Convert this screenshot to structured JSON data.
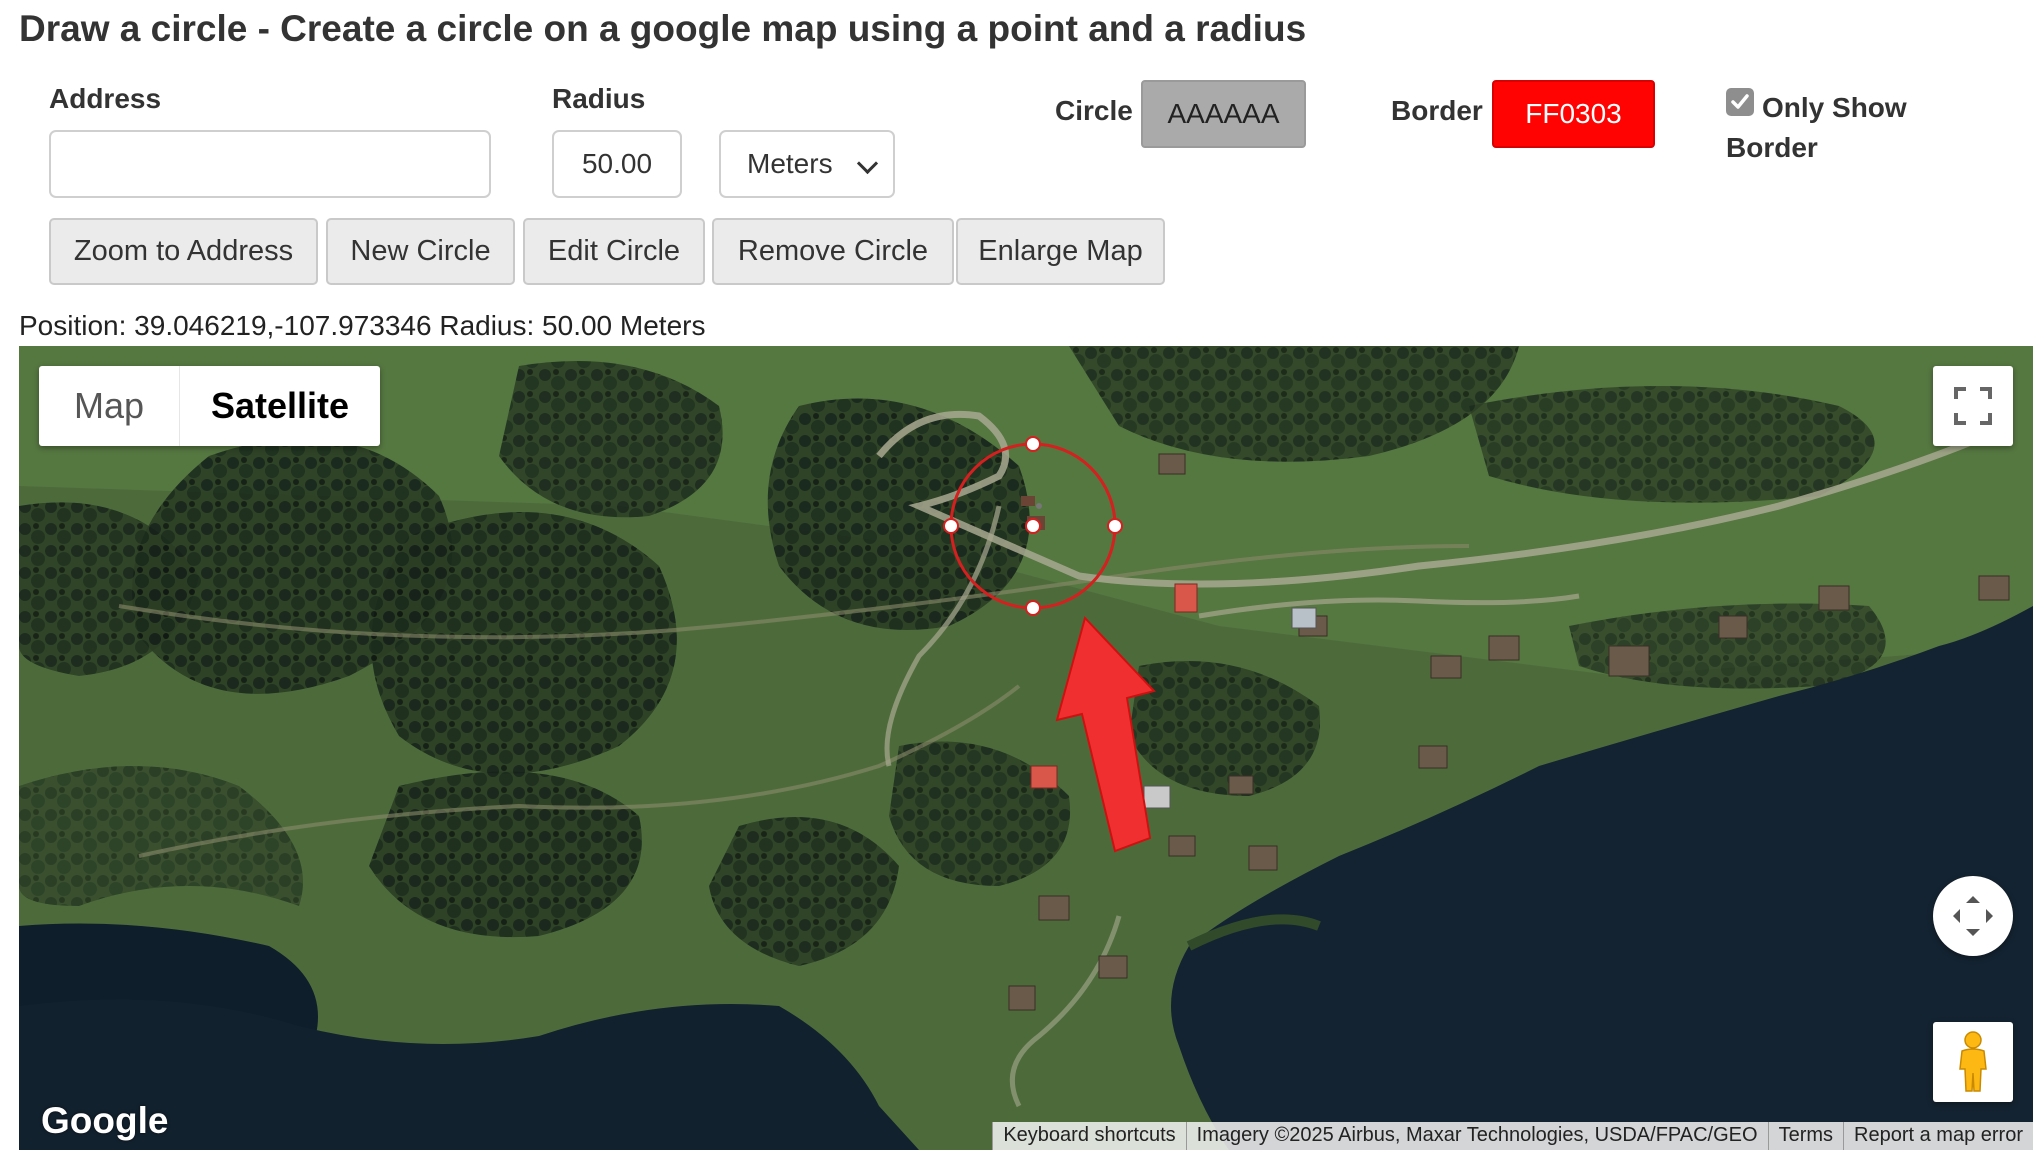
{
  "page": {
    "title": "Draw a circle - Create a circle on a google map using a point and a radius"
  },
  "form": {
    "address_label": "Address",
    "address_value": "",
    "radius_label": "Radius",
    "radius_value": "50.00",
    "unit_selected": "Meters",
    "circle_label": "Circle",
    "circle_color": "AAAAAA",
    "border_label": "Border",
    "border_color": "FF0303",
    "only_show_border_label": "Only Show Border",
    "only_show_border_checked": true
  },
  "buttons": {
    "zoom": "Zoom to Address",
    "new": "New Circle",
    "edit": "Edit Circle",
    "remove": "Remove Circle",
    "enlarge": "Enlarge Map"
  },
  "status": "Position: 39.046219,-107.973346 Radius: 50.00 Meters",
  "map": {
    "type_map": "Map",
    "type_satellite": "Satellite",
    "selected_type": "Satellite",
    "logo": "Google",
    "attribution": {
      "shortcuts": "Keyboard shortcuts",
      "imagery": "Imagery ©2025 Airbus, Maxar Technologies, USDA/FPAC/GEO",
      "terms": "Terms",
      "report": "Report a map error"
    },
    "circle_stroke": "#d61f1f",
    "arrow_color": "#f03030",
    "icons": [
      "fullscreen-icon",
      "camera-control-icon",
      "pegman-icon"
    ]
  },
  "colors": {
    "circle_swatch": "#AAAAAA",
    "border_swatch": "#FF0303"
  }
}
